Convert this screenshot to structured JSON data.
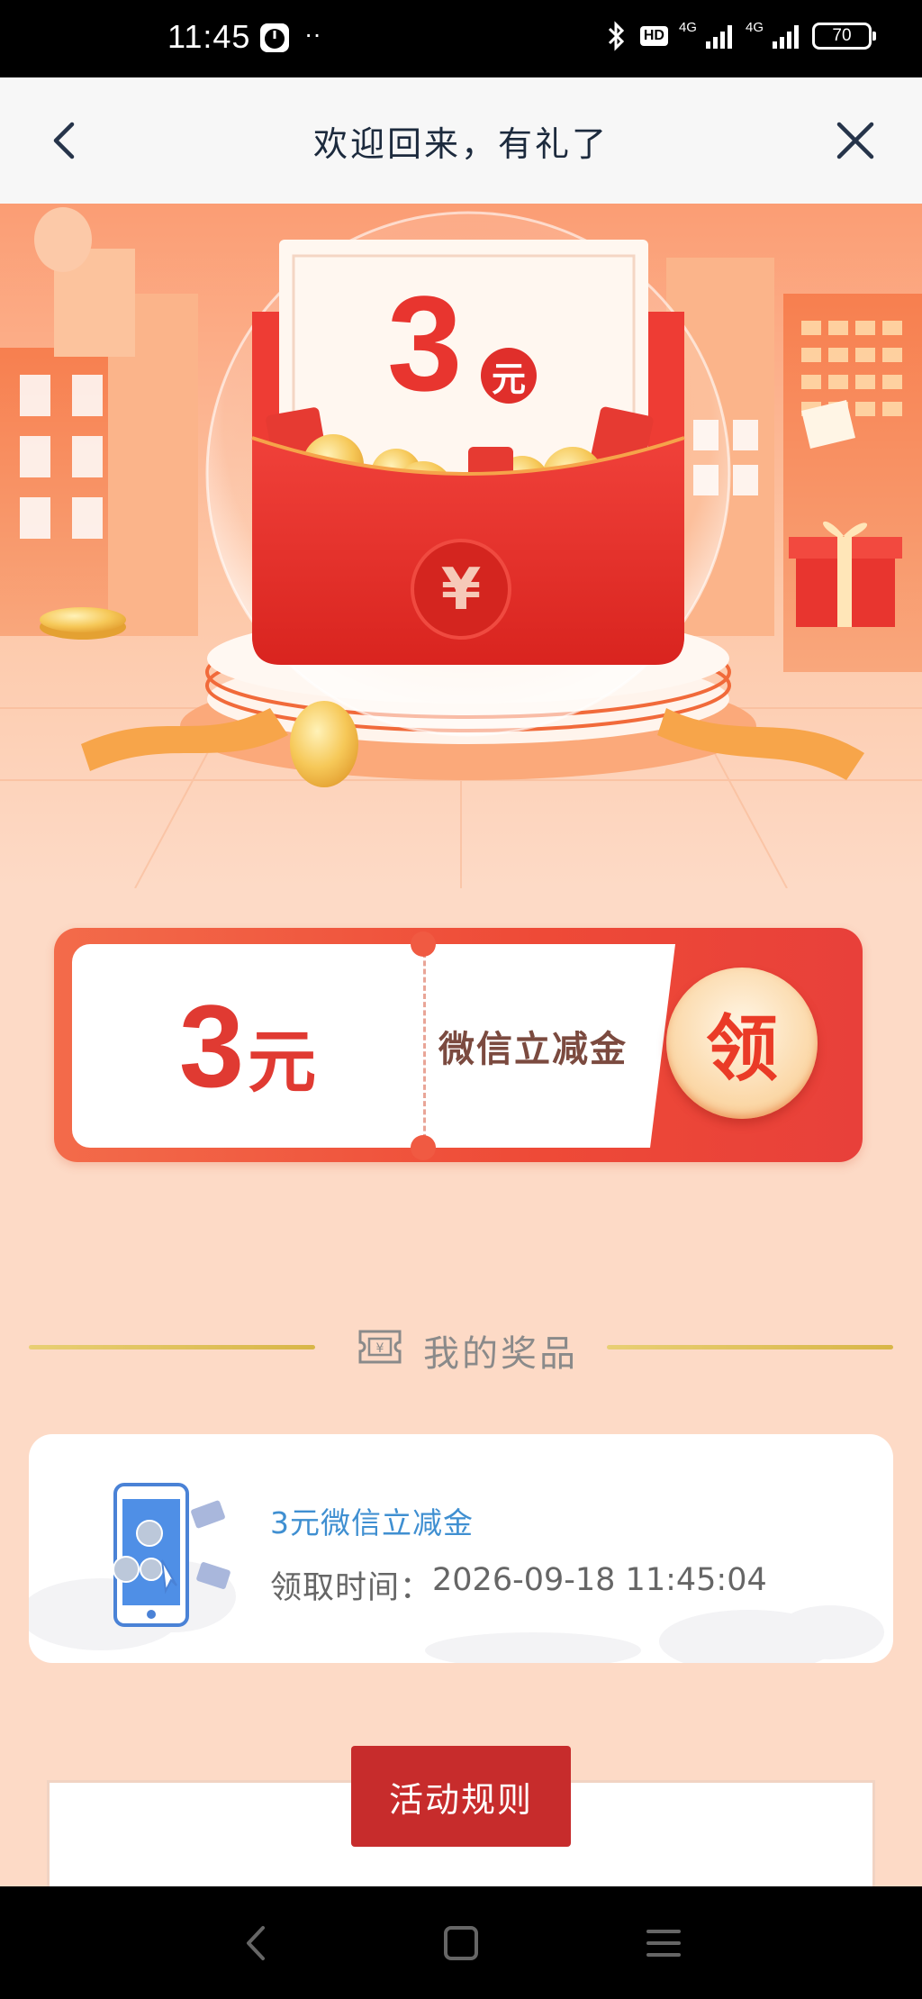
{
  "status_bar": {
    "time": "11:45",
    "dots": "··",
    "hd": "HD",
    "net1": "4G",
    "net2": "4G",
    "battery": "70"
  },
  "nav": {
    "title": "欢迎回来，有礼了"
  },
  "hero": {
    "amount": "3",
    "unit": "元"
  },
  "coupon": {
    "amount": "3",
    "unit": "元",
    "label": "微信立减金",
    "claim_label": "领"
  },
  "section": {
    "title": "我的奖品"
  },
  "prize": {
    "name": "3元微信立减金",
    "time_label": "领取时间：",
    "time_value": "2026-09-18 11:45:04"
  },
  "rules": {
    "button_label": "活动规则"
  },
  "colors": {
    "page_bg": "#fddac6",
    "accent_red": "#e8352f",
    "rules_button": "#c72c2c",
    "prize_name_blue": "#3f8fd1",
    "section_line_gold": "#d8b648"
  }
}
